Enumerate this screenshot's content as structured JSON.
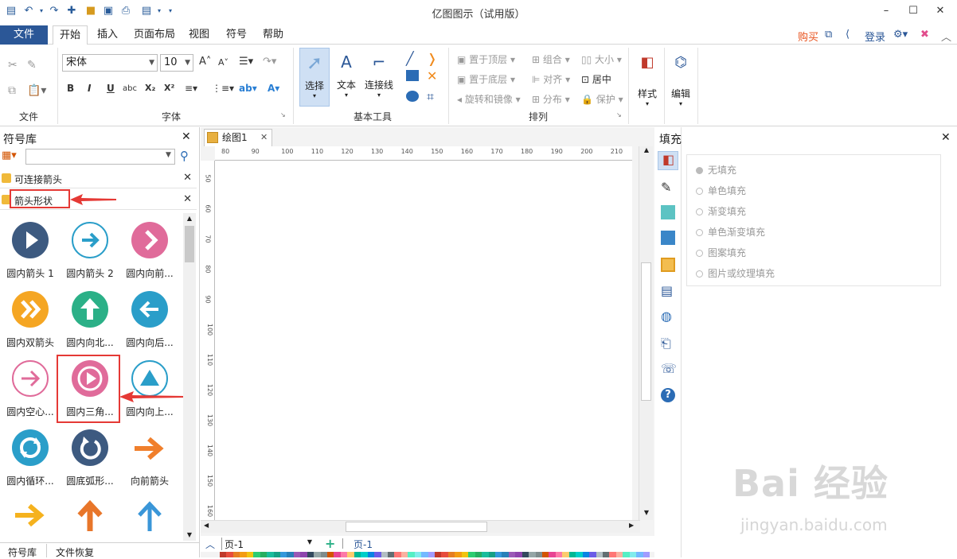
{
  "window": {
    "title": "亿图图示（试用版）"
  },
  "menu": {
    "file": "文件",
    "tabs": [
      "开始",
      "插入",
      "页面布局",
      "视图",
      "符号",
      "帮助"
    ],
    "buy": "购买",
    "login": "登录"
  },
  "ribbon": {
    "groups": {
      "file": "文件",
      "font": "字体",
      "basic_tools": "基本工具",
      "arrange": "排列"
    },
    "font_name": "宋体",
    "font_size": "10",
    "tools": {
      "select": "选择",
      "text": "文本",
      "connector": "连接线"
    },
    "arrange": {
      "bring_front": "置于顶层",
      "group": "组合",
      "size": "大小",
      "send_back": "置于底层",
      "align": "对齐",
      "center": "居中",
      "rotate": "旋转和镜像",
      "distribute": "分布",
      "protect": "保护"
    },
    "style": "样式",
    "edit": "编辑"
  },
  "library": {
    "title": "符号库",
    "search_placeholder": "",
    "categories": [
      "可连接箭头",
      "箭头形状"
    ],
    "symbols": [
      {
        "label": "圆内箭头 1",
        "color": "#3d5a80"
      },
      {
        "label": "圆内箭头 2",
        "color": "#ffffff"
      },
      {
        "label": "圆内向前...",
        "color": "#e06b9a"
      },
      {
        "label": "圆内双箭头",
        "color": "#f5a623"
      },
      {
        "label": "圆内向北...",
        "color": "#2bb087"
      },
      {
        "label": "圆内向后...",
        "color": "#2a9ec9"
      },
      {
        "label": "圆内空心...",
        "color": "#ffffff"
      },
      {
        "label": "圆内三角...",
        "color": "#e06b9a"
      },
      {
        "label": "圆内向上...",
        "color": "#ffffff"
      },
      {
        "label": "圆内循环...",
        "color": "#2a9ec9"
      },
      {
        "label": "圆底弧形...",
        "color": "#3d5a80"
      },
      {
        "label": "向前箭头",
        "color": "#f07f2c"
      }
    ],
    "bottom_tabs": [
      "符号库",
      "文件恢复"
    ]
  },
  "canvas": {
    "doc_tab": "绘图1",
    "ruler_h": [
      "80",
      "90",
      "100",
      "110",
      "120",
      "130",
      "140",
      "150",
      "160",
      "170",
      "180",
      "190",
      "200",
      "210"
    ],
    "ruler_v": [
      "50",
      "60",
      "70",
      "80",
      "90",
      "100",
      "110",
      "120",
      "130",
      "140",
      "150",
      "160"
    ],
    "page_select": "页-1",
    "page_tab": "页-1"
  },
  "fill": {
    "title": "填充",
    "options": [
      "无填充",
      "单色填充",
      "渐变填充",
      "单色渐变填充",
      "图案填充",
      "图片或纹理填充"
    ]
  },
  "watermark": {
    "main": "Bai 经验",
    "sub": "jingyan.baidu.com"
  }
}
